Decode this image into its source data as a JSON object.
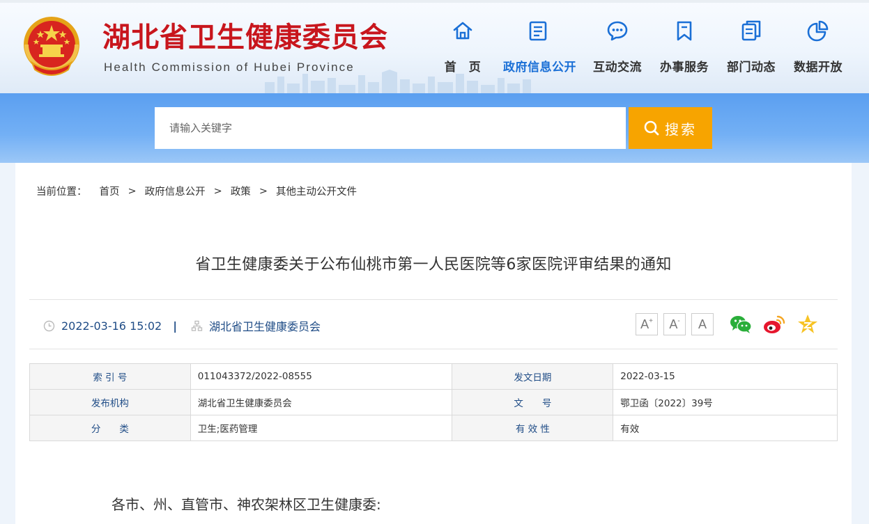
{
  "header": {
    "site_title": "湖北省卫生健康委员会",
    "site_subtitle": "Health Commission of Hubei Province",
    "nav": [
      {
        "label": "首　页",
        "icon": "home-icon",
        "active": false
      },
      {
        "label": "政府信息公开",
        "icon": "document-list-icon",
        "active": true
      },
      {
        "label": "互动交流",
        "icon": "chat-bubble-icon",
        "active": false
      },
      {
        "label": "办事服务",
        "icon": "bookmark-icon",
        "active": false
      },
      {
        "label": "部门动态",
        "icon": "news-pages-icon",
        "active": false
      },
      {
        "label": "数据开放",
        "icon": "pie-chart-icon",
        "active": false
      }
    ]
  },
  "search": {
    "placeholder": "请输入关键字",
    "button_label": "搜索"
  },
  "breadcrumb": {
    "label": "当前位置：",
    "items": [
      "首页",
      "政府信息公开",
      "政策",
      "其他主动公开文件"
    ],
    "separator": ">"
  },
  "article": {
    "title": "省卫生健康委关于公布仙桃市第一人民医院等6家医院评审结果的通知",
    "datetime": "2022-03-16 15:02",
    "meta_divider": "|",
    "publisher": "湖北省卫生健康委员会",
    "font_size_buttons": [
      "A",
      "A",
      "A"
    ],
    "share": [
      "wechat-icon",
      "weibo-icon",
      "qzone-icon"
    ],
    "salutation": "各市、州、直管市、神农架林区卫生健康委:"
  },
  "info_table": {
    "rows": [
      [
        {
          "key": "索 引 号",
          "value": "011043372/2022-08555"
        },
        {
          "key": "发文日期",
          "value": "2022-03-15"
        }
      ],
      [
        {
          "key": "发布机构",
          "value": "湖北省卫生健康委员会"
        },
        {
          "key": "文　　号",
          "value": "鄂卫函〔2022〕39号"
        }
      ],
      [
        {
          "key": "分　　类",
          "value": "卫生;医药管理"
        },
        {
          "key": "有 效 性",
          "value": "有效"
        }
      ]
    ]
  },
  "colors": {
    "title_red": "#c8161d",
    "nav_active": "#1a6fd6",
    "search_button": "#f7a400",
    "meta_blue": "#1f4c86"
  }
}
